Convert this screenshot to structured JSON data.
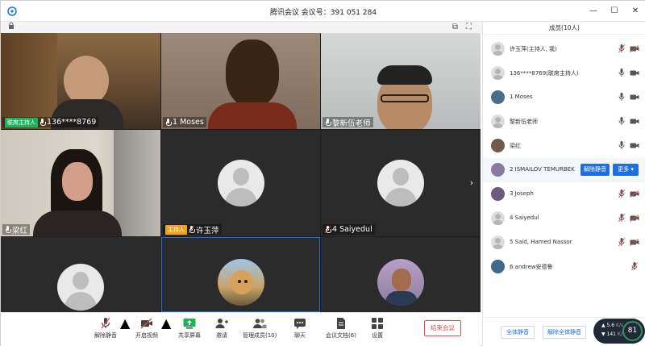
{
  "window": {
    "title": "腾讯会议 会议号：391 051 284",
    "buttons": [
      "minimize",
      "maximize",
      "close"
    ]
  },
  "stage": {
    "icons": [
      "pin-window-icon",
      "fullscreen-icon"
    ]
  },
  "tiles": [
    {
      "id": "t1",
      "tag": "联席主持人",
      "name": "136****8769",
      "mic": "on"
    },
    {
      "id": "t2",
      "tag": "",
      "name": "1 Moses",
      "mic": "on"
    },
    {
      "id": "t3",
      "tag": "",
      "name": "黎新伍老师",
      "mic": "on"
    },
    {
      "id": "t4",
      "tag": "",
      "name": "梁红",
      "mic": "on"
    },
    {
      "id": "t5",
      "tag": "主持人",
      "name": "许玉萍",
      "mic": "off"
    },
    {
      "id": "t6",
      "tag": "",
      "name": "4 Saiyedul",
      "mic": "off"
    }
  ],
  "toolbar": {
    "items": [
      {
        "label": "解除静音",
        "icon": "mic-muted-icon"
      },
      {
        "label": "开启视频",
        "icon": "camera-off-icon"
      },
      {
        "label": "共享屏幕",
        "icon": "share-screen-icon"
      },
      {
        "label": "邀请",
        "icon": "invite-icon"
      },
      {
        "label": "管理成员(10)",
        "icon": "members-icon"
      },
      {
        "label": "聊天",
        "icon": "chat-icon"
      },
      {
        "label": "会议文档(6)",
        "icon": "document-icon"
      },
      {
        "label": "设置",
        "icon": "settings-icon"
      }
    ],
    "end_label": "结束会议"
  },
  "panel": {
    "title": "成员(10人)",
    "members": [
      {
        "name": "许玉萍(主持人, 我)",
        "mic": "off",
        "cam": "off",
        "avatar": "default"
      },
      {
        "name": "136****8769(联席主持人)",
        "mic": "on",
        "cam": "on",
        "avatar": "default"
      },
      {
        "name": "1 Moses",
        "mic": "on",
        "cam": "on",
        "avatar": "photo"
      },
      {
        "name": "黎新伍老师",
        "mic": "on",
        "cam": "on",
        "avatar": "default"
      },
      {
        "name": "梁红",
        "mic": "on",
        "cam": "on",
        "avatar": "photo"
      },
      {
        "name": "2 ISMAILOV TEMURBEK",
        "mic": "",
        "cam": "",
        "avatar": "photo",
        "actions": [
          "解除静音",
          "更多 ▾"
        ]
      },
      {
        "name": "3 Joseph",
        "mic": "off",
        "cam": "off",
        "avatar": "photo"
      },
      {
        "name": "4 Saiyedul",
        "mic": "off",
        "cam": "off",
        "avatar": "default"
      },
      {
        "name": "5 Said, Hamed Nassor",
        "mic": "off",
        "cam": "off",
        "avatar": "default"
      },
      {
        "name": "6 andrew安德鲁",
        "mic": "off",
        "cam": "",
        "avatar": "photo"
      }
    ],
    "mute_all": "全体静音",
    "unmute_all": "解除全体静音"
  },
  "network": {
    "up": "5.6",
    "up_unit": "K/s",
    "down": "141",
    "down_unit": "K/s",
    "percent": "81"
  }
}
